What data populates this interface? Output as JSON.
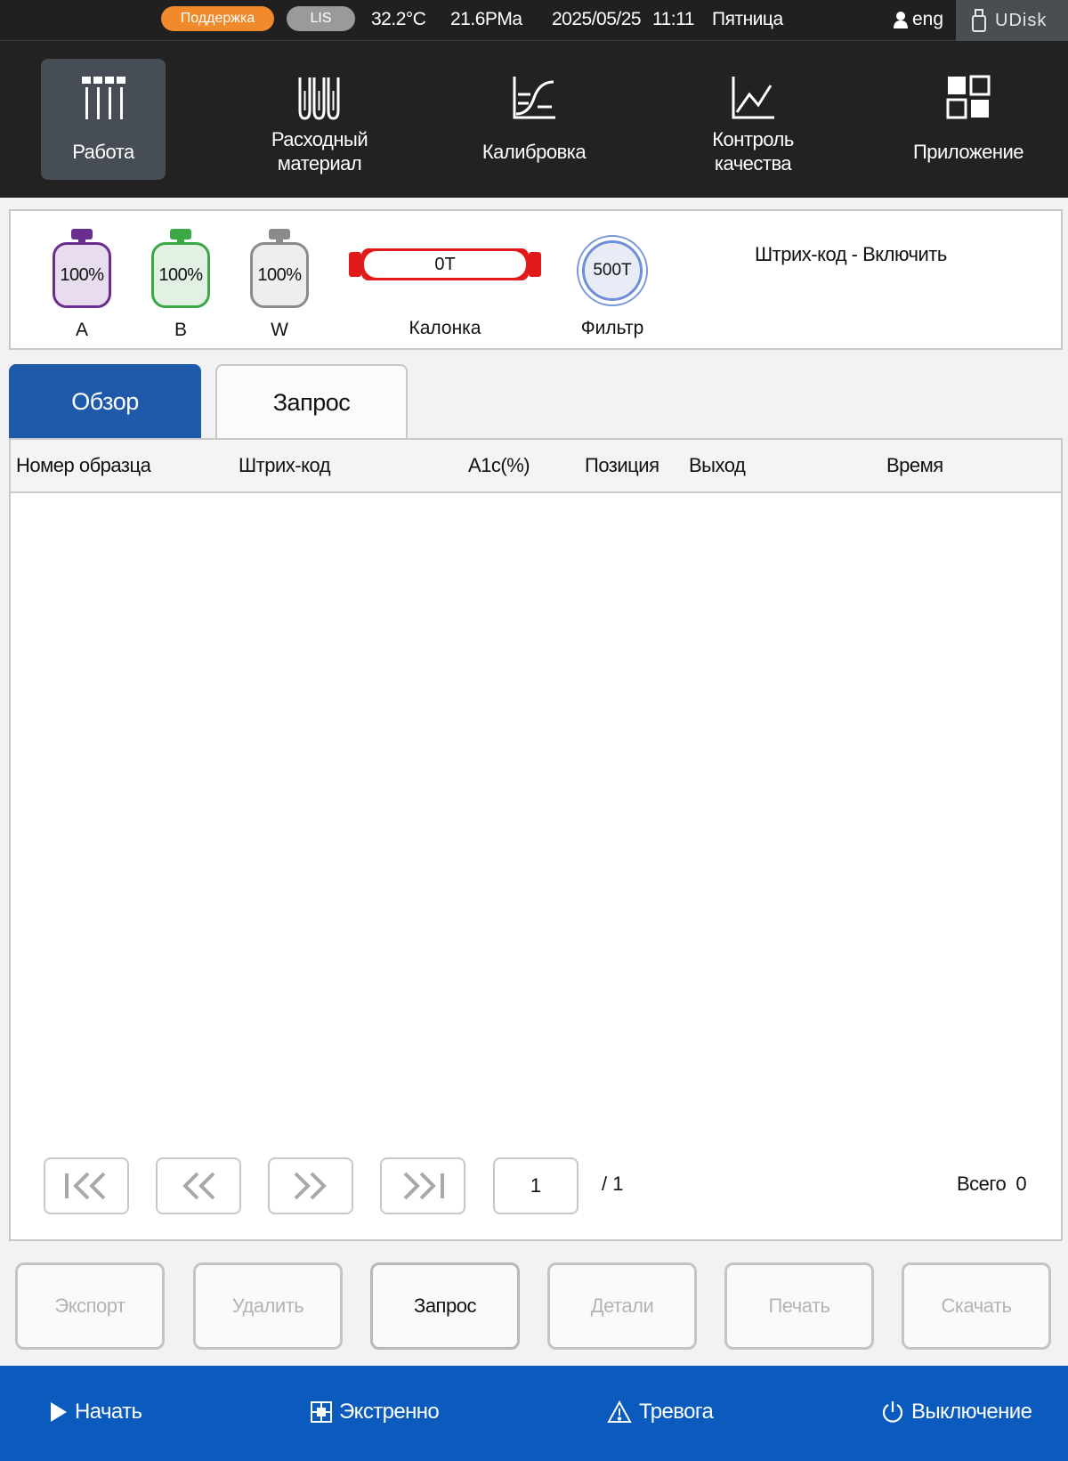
{
  "status": {
    "support_label": "Поддержка",
    "lis_label": "LIS",
    "temperature": "32.2°C",
    "pressure": "21.6PMa",
    "date": "2025/05/25",
    "time": "11:11",
    "weekday": "Пятница",
    "language": "eng",
    "udisk_label": "UDisk",
    "colors": {
      "support": "#f08a2a",
      "lis": "#9a9a9a"
    }
  },
  "nav": {
    "items": [
      {
        "label": "Работа",
        "icon": "test-tubes-rack-icon",
        "active": true
      },
      {
        "label": "Расходный\nматериал",
        "icon": "reagent-tubes-icon",
        "active": false
      },
      {
        "label": "Калибровка",
        "icon": "calibration-curve-icon",
        "active": false
      },
      {
        "label": "Контроль\nкачества",
        "icon": "line-chart-icon",
        "active": false
      },
      {
        "label": "Приложение",
        "icon": "apps-grid-icon",
        "active": false
      }
    ]
  },
  "reagents": {
    "bottles": [
      {
        "name": "A",
        "level": "100%",
        "color": "#6a2f8e",
        "fill": "#e8dcef"
      },
      {
        "name": "B",
        "level": "100%",
        "color": "#39a845",
        "fill": "#e3f1e4"
      },
      {
        "name": "W",
        "level": "100%",
        "color": "#8b8b8b",
        "fill": "#eeeeee"
      }
    ],
    "column": {
      "value": "0T",
      "label": "Калонка",
      "color": "#e11b1b"
    },
    "filter": {
      "value": "500T",
      "label": "Фильтр"
    },
    "barcode_status": "Штрих-код - Включить"
  },
  "tabs": [
    {
      "label": "Обзор",
      "active": true
    },
    {
      "label": "Запрос",
      "active": false
    }
  ],
  "table": {
    "headers": [
      "Номер образца",
      "Штрих-код",
      "A1c(%)",
      "Позиция",
      "Выход",
      "Время"
    ],
    "rows": []
  },
  "pagination": {
    "current_page": "1",
    "total_pages": "/ 1",
    "total_label": "Всего",
    "total_count": "0"
  },
  "actions": [
    {
      "label": "Экспорт",
      "enabled": false
    },
    {
      "label": "Удалить",
      "enabled": false
    },
    {
      "label": "Запрос",
      "enabled": true
    },
    {
      "label": "Детали",
      "enabled": false
    },
    {
      "label": "Печать",
      "enabled": false
    },
    {
      "label": "Скачать",
      "enabled": false
    }
  ],
  "footer": {
    "start": "Начать",
    "emergency": "Экстренно",
    "alarm": "Тревога",
    "shutdown": "Выключение",
    "color": "#0a5bbd"
  }
}
